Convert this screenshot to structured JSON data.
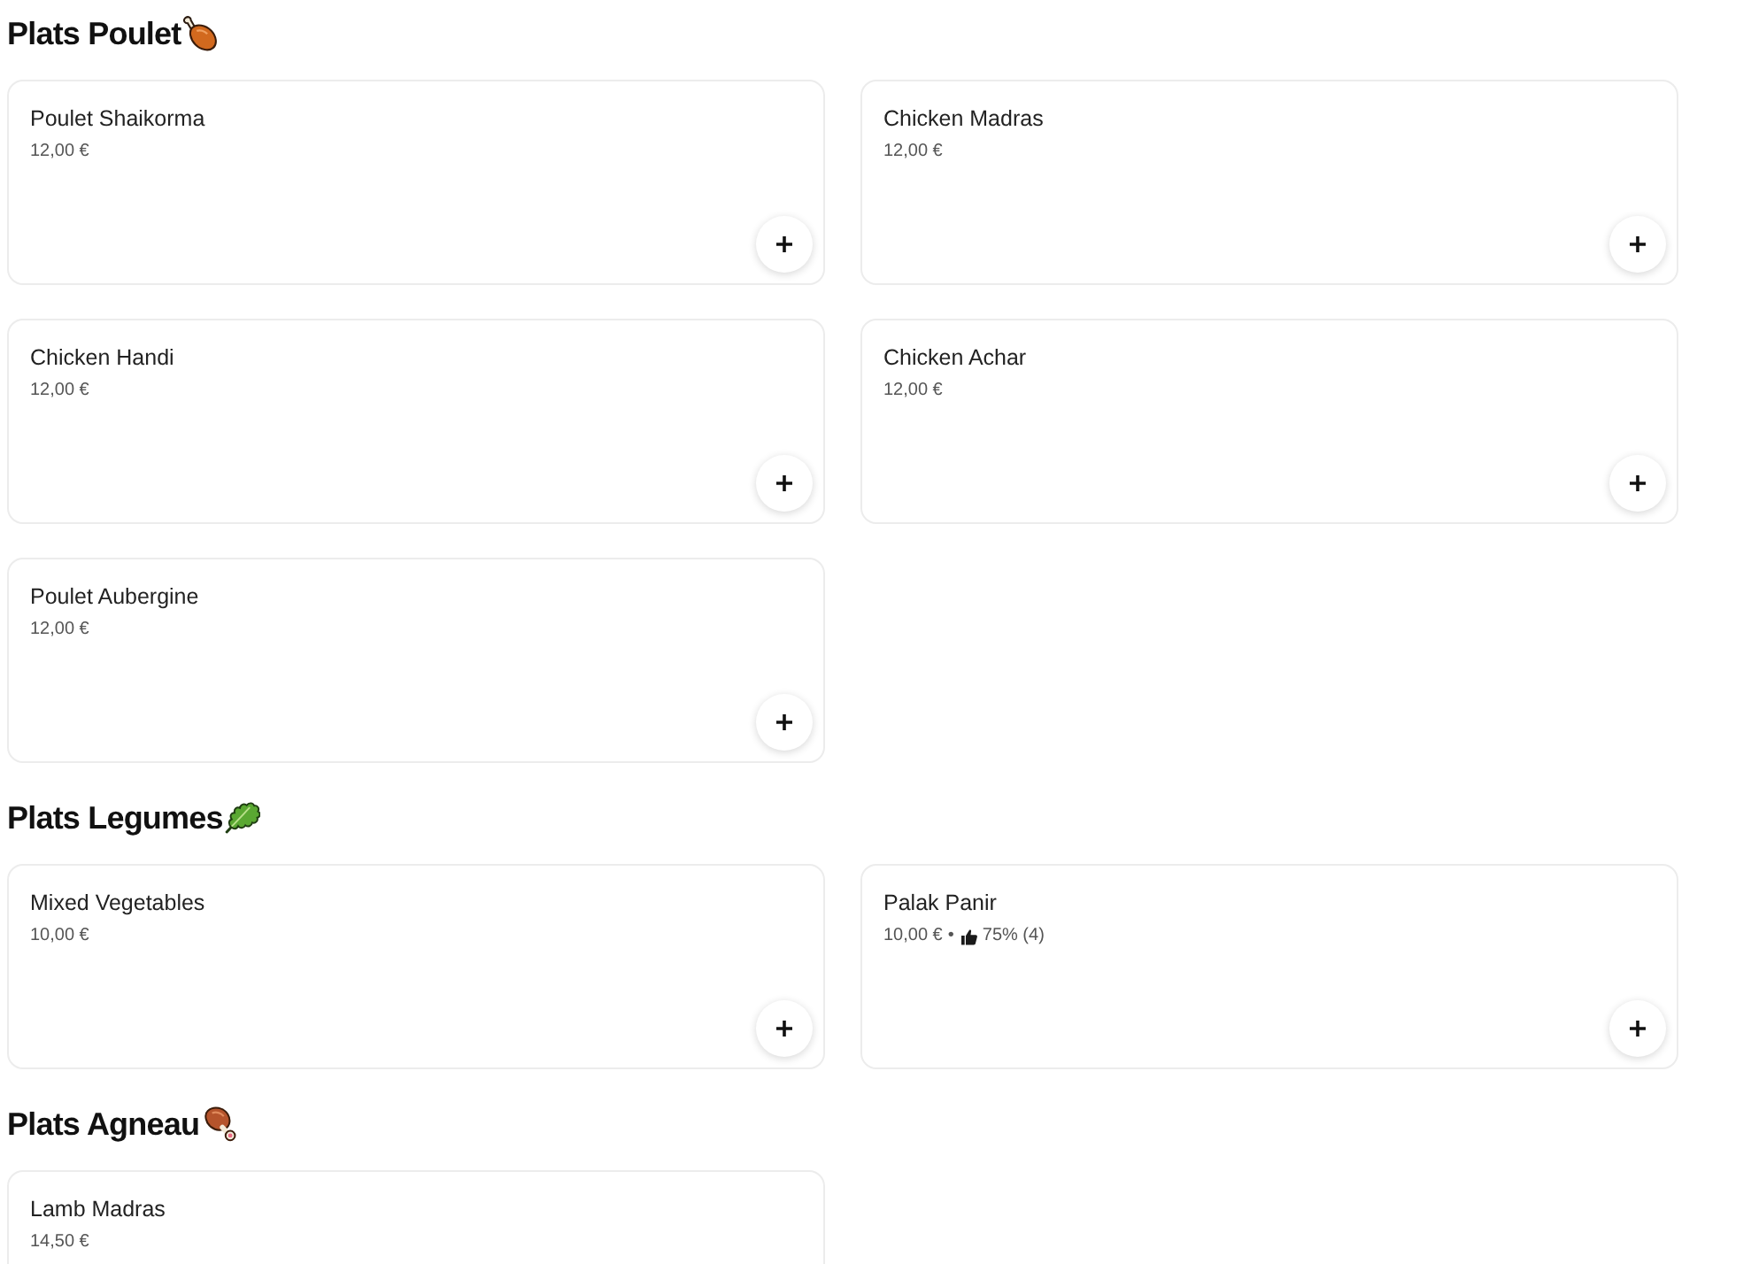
{
  "sections": [
    {
      "title": "Plats Poulet",
      "kind": "chicken",
      "items": [
        {
          "name": "Poulet Shaikorma",
          "price": "12,00 €",
          "add_button": true
        },
        {
          "name": "Chicken Madras",
          "price": "12,00 €",
          "add_button": true
        },
        {
          "name": "Chicken Handi",
          "price": "12,00 €",
          "add_button": true
        },
        {
          "name": "Chicken Achar",
          "price": "12,00 €",
          "add_button": true
        },
        {
          "name": "Poulet Aubergine",
          "price": "12,00 €",
          "add_button": true
        }
      ]
    },
    {
      "title": "Plats Legumes",
      "kind": "vegetables",
      "items": [
        {
          "name": "Mixed Vegetables",
          "price": "10,00 €",
          "add_button": true
        },
        {
          "name": "Palak Panir",
          "price": "10,00 €",
          "separator": "•",
          "rating": "75% (4)",
          "add_button": true
        }
      ]
    },
    {
      "title": "Plats Agneau",
      "kind": "lamb",
      "items": [
        {
          "name": "Lamb Madras",
          "price": "14,50 €"
        }
      ]
    }
  ]
}
